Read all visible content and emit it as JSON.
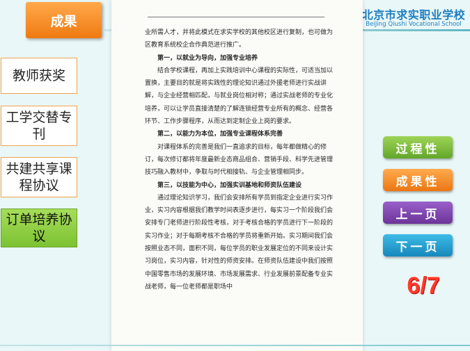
{
  "header": {
    "title": "成果",
    "school_name": "北京市求实职业学校",
    "school_name_en": "BeiJing Qiushi Vocational School"
  },
  "nav": {
    "items": [
      {
        "label": "教师获奖",
        "active": false
      },
      {
        "label": "工学交替专刊",
        "active": false
      },
      {
        "label": "共建共享课程协议",
        "active": false
      },
      {
        "label": "订单培养协议",
        "active": true
      }
    ]
  },
  "document": {
    "paragraphs": [
      {
        "style": "plain",
        "text": "业所需人才，并将此模式在求实学校的其他校区进行复制，也可做为区教育系统校企合作典范进行推广。"
      },
      {
        "style": "hd",
        "text": "第一，以就业为导向，加强专业培养"
      },
      {
        "style": "ind",
        "text": "结合学校课程，再加上实践培训中心课程的实际性，可适当加以置换，主要目的就是将实践性的理论知识通过外援老师进行实战讲解，与企业经营相匹配，与就业岗位相对称；通过实战老师的专业化培养，可以让学员直接清楚的了解连锁经营专业所有的概念、经营各环节、工作步骤程序，从而达到定制企业上岗的要求。"
      },
      {
        "style": "hd",
        "text": "第二，以能力为本位，加强专业课程体系完善"
      },
      {
        "style": "ind",
        "text": "对课程体系的完善是我们一直追求的目标，每年都做精心的修订，每次修订都将年度最新业态商品组合、营销手段、科学先进管理技巧融入教材中，争取与时代相接轨、与企业管理相同步。"
      },
      {
        "style": "hd",
        "text": "第三，以技能为中心，加强实训基地和师资队伍建设"
      },
      {
        "style": "ind",
        "text": "通过理论知识学习，我们会安排所有学员到指定企业进行实习作业，实习内容根据我们教学时间表逐步进行，每实习一个阶段我们会安排专门老师进行阶段性考核，对于考核合格的学员进行下一阶段的实习作业；对于每期考核不合格的学员将重新开始。实习期间我们会按照业态不同，面积不同，每位学员的职业发展定位的不同来设计实习岗位，实习内容，针对性的师资安排。在师资队伍建设中我们按照中国零售市场的发展环境、市场发展需求、行业发展前景配备专业实战老师，每一位老师都是职场中"
      }
    ]
  },
  "side": {
    "process_label": "过程性",
    "result_label": "成果性",
    "prev_label": "上一页",
    "next_label": "下一页",
    "page_indicator": "6/7"
  },
  "colors": {
    "accent_orange": "#ef7a12",
    "accent_green": "#7cc232",
    "accent_purple": "#6c3499",
    "accent_blue": "#1688bc",
    "school_blue": "#1c7ec0",
    "indicator_red": "#ff3a2a"
  }
}
